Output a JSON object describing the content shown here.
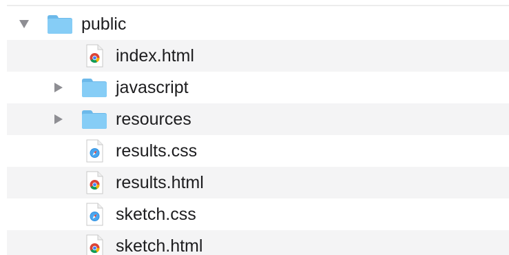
{
  "colors": {
    "folder": "#7cc4f0",
    "folder_tab": "#6cb9ea",
    "stripe": "#f4f4f5",
    "disclosure": "#8e8e93",
    "text": "#1d1d1f"
  },
  "tree": {
    "root": {
      "label": "public",
      "expanded": true,
      "icon": "folder-icon"
    },
    "items": [
      {
        "label": "index.html",
        "type": "file",
        "icon": "chrome-html-icon"
      },
      {
        "label": "javascript",
        "type": "folder",
        "expanded": false,
        "icon": "folder-icon"
      },
      {
        "label": "resources",
        "type": "folder",
        "expanded": false,
        "icon": "folder-icon"
      },
      {
        "label": "results.css",
        "type": "file",
        "icon": "safari-css-icon"
      },
      {
        "label": "results.html",
        "type": "file",
        "icon": "chrome-html-icon"
      },
      {
        "label": "sketch.css",
        "type": "file",
        "icon": "safari-css-icon"
      },
      {
        "label": "sketch.html",
        "type": "file",
        "icon": "chrome-html-icon"
      }
    ]
  }
}
